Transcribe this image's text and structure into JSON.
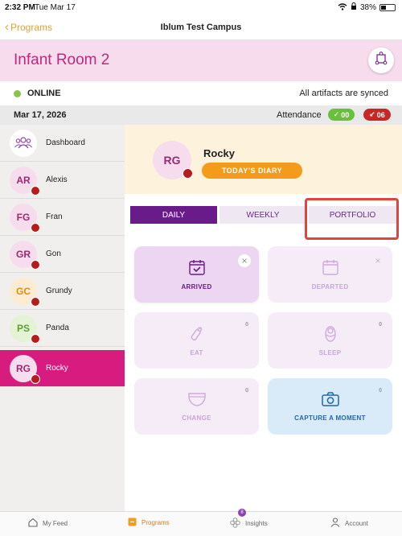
{
  "status_bar": {
    "time": "2:32 PM",
    "date": "Tue Mar 17",
    "battery": "38%"
  },
  "nav": {
    "back_label": "Programs",
    "title": "Iblum Test Campus"
  },
  "room": {
    "title": "Infant Room 2"
  },
  "sync": {
    "status": "ONLINE",
    "message": "All artifacts are synced"
  },
  "date_bar": {
    "date": "Mar 17, 2026",
    "attendance_label": "Attendance",
    "present": "00",
    "absent": "06"
  },
  "sidebar": {
    "items": [
      {
        "initials": "",
        "name": "Dashboard",
        "avatar_bg": "#ffffff",
        "avatar_fg": "#8e44ad"
      },
      {
        "initials": "AR",
        "name": "Alexis",
        "avatar_bg": "#f6dcec",
        "avatar_fg": "#9c2a73"
      },
      {
        "initials": "FG",
        "name": "Fran",
        "avatar_bg": "#f6dcec",
        "avatar_fg": "#9c2a73"
      },
      {
        "initials": "GR",
        "name": "Gon",
        "avatar_bg": "#f6dcec",
        "avatar_fg": "#9c2a73"
      },
      {
        "initials": "GC",
        "name": "Grundy",
        "avatar_bg": "#fdecd2",
        "avatar_fg": "#e08a1a"
      },
      {
        "initials": "PS",
        "name": "Panda",
        "avatar_bg": "#e4f3d6",
        "avatar_fg": "#5ba02e"
      },
      {
        "initials": "RG",
        "name": "Rocky",
        "avatar_bg": "#f6dcec",
        "avatar_fg": "#9c2a73"
      }
    ]
  },
  "profile": {
    "initials": "RG",
    "name": "Rocky",
    "diary_button": "TODAY'S DIARY"
  },
  "tabs": {
    "daily": "DAILY",
    "weekly": "WEEKLY",
    "portfolio": "PORTFOLIO"
  },
  "tiles": {
    "arrived": {
      "label": "ARRIVED"
    },
    "departed": {
      "label": "DEPARTED"
    },
    "eat": {
      "label": "EAT",
      "count": "0"
    },
    "sleep": {
      "label": "SLEEP",
      "count": "0"
    },
    "change": {
      "label": "CHANGE",
      "count": "0"
    },
    "capture": {
      "label": "CAPTURE A MOMENT",
      "count": "0"
    }
  },
  "tabbar": {
    "feed": "My Feed",
    "programs": "Programs",
    "insights": "Insights",
    "insights_badge": "8",
    "account": "Account"
  },
  "colors": {
    "brand_pink": "#d81b7f",
    "brand_purple": "#6a1b8a",
    "accent_orange": "#f59b1c",
    "online_green": "#8bc34a"
  }
}
